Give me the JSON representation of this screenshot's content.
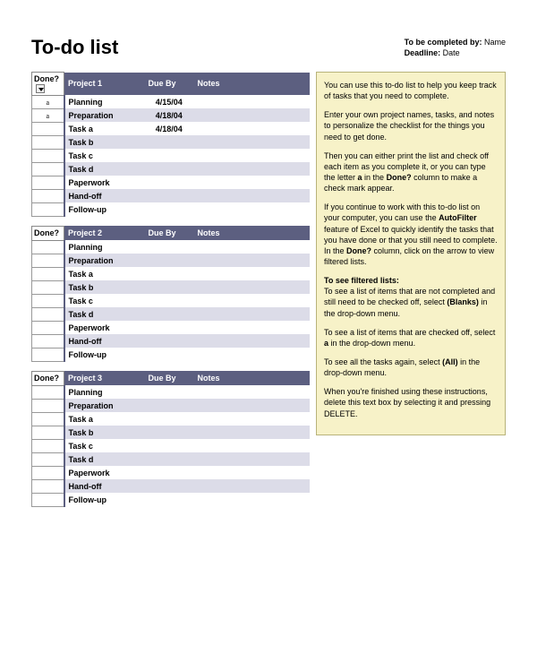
{
  "title": "To-do list",
  "meta": {
    "completed_label": "To be completed by:",
    "completed_value": "Name",
    "deadline_label": "Deadline:",
    "deadline_value": "Date"
  },
  "columns": {
    "done": "Done?",
    "due": "Due By",
    "notes": "Notes"
  },
  "projects": [
    {
      "name": "Project 1",
      "has_filter": true,
      "rows": [
        {
          "done": "a",
          "task": "Planning",
          "due": "4/15/04"
        },
        {
          "done": "a",
          "task": "Preparation",
          "due": "4/18/04"
        },
        {
          "done": "",
          "task": "Task a",
          "due": "4/18/04"
        },
        {
          "done": "",
          "task": "Task b",
          "due": ""
        },
        {
          "done": "",
          "task": "Task c",
          "due": ""
        },
        {
          "done": "",
          "task": "Task d",
          "due": ""
        },
        {
          "done": "",
          "task": "Paperwork",
          "due": ""
        },
        {
          "done": "",
          "task": "Hand-off",
          "due": ""
        },
        {
          "done": "",
          "task": "Follow-up",
          "due": ""
        }
      ]
    },
    {
      "name": "Project 2",
      "has_filter": false,
      "rows": [
        {
          "done": "",
          "task": "Planning",
          "due": ""
        },
        {
          "done": "",
          "task": "Preparation",
          "due": ""
        },
        {
          "done": "",
          "task": "Task a",
          "due": ""
        },
        {
          "done": "",
          "task": "Task b",
          "due": ""
        },
        {
          "done": "",
          "task": "Task c",
          "due": ""
        },
        {
          "done": "",
          "task": "Task d",
          "due": ""
        },
        {
          "done": "",
          "task": "Paperwork",
          "due": ""
        },
        {
          "done": "",
          "task": "Hand-off",
          "due": ""
        },
        {
          "done": "",
          "task": "Follow-up",
          "due": ""
        }
      ]
    },
    {
      "name": "Project 3",
      "has_filter": false,
      "rows": [
        {
          "done": "",
          "task": "Planning",
          "due": ""
        },
        {
          "done": "",
          "task": "Preparation",
          "due": ""
        },
        {
          "done": "",
          "task": "Task a",
          "due": ""
        },
        {
          "done": "",
          "task": "Task b",
          "due": ""
        },
        {
          "done": "",
          "task": "Task c",
          "due": ""
        },
        {
          "done": "",
          "task": "Task d",
          "due": ""
        },
        {
          "done": "",
          "task": "Paperwork",
          "due": ""
        },
        {
          "done": "",
          "task": "Hand-off",
          "due": ""
        },
        {
          "done": "",
          "task": "Follow-up",
          "due": ""
        }
      ]
    }
  ],
  "instructions": {
    "p1": "You can use this to-do list to help you keep track of tasks that you need to complete.",
    "p2": "Enter your own project names, tasks, and notes to personalize the checklist for the things you need to get done.",
    "p3a": "Then you can either print the list and check off each item as you complete it, or you can type the letter ",
    "p3b": "a",
    "p3c": " in the ",
    "p3d": "Done?",
    "p3e": " column to make a check mark appear.",
    "p4a": "If you continue to work with this to-do list on your computer, you can use the ",
    "p4b": "AutoFilter",
    "p4c": " feature of Excel to quickly identify the tasks that you have done or that you still need to complete. In the ",
    "p4d": "Done?",
    "p4e": " column, click on the arrow to view filtered lists.",
    "p5a": "To see filtered lists:",
    "p5b": "To see a list of items that are not completed and still need to be checked off, select ",
    "p5c": "(Blanks)",
    "p5d": " in the drop-down menu.",
    "p6a": "To see a list of items that are checked off, select ",
    "p6b": "a",
    "p6c": " in the drop-down menu.",
    "p7a": "To see all the tasks again, select ",
    "p7b": "(All)",
    "p7c": " in the drop-down menu.",
    "p8": "When you're finished using these instructions, delete this text box by selecting it and pressing DELETE."
  }
}
